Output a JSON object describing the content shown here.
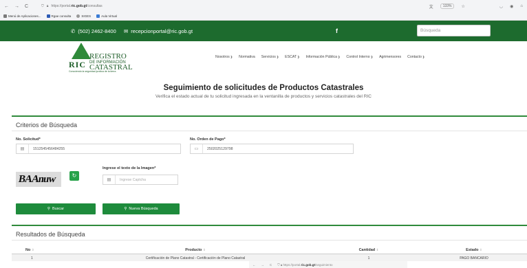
{
  "browser": {
    "nav": [
      "←",
      "→",
      "C"
    ],
    "url_prefix": "https://portal.",
    "url_host": "ric.gob.gt",
    "url_path": "/consultas",
    "zoom": "133%",
    "bookmarks": [
      "Menú de Aplicaciones...",
      "Rgae consulta",
      "SIGES",
      "Aula Virtual"
    ]
  },
  "topbar": {
    "phone": "(502) 2462-8400",
    "email": "recepcionportal@ric.gob.gt",
    "facebook": "f",
    "search_placeholder": "Búsqueda"
  },
  "logo": {
    "line1": "REGISTRO",
    "line2": "DE INFORMACIÓN",
    "line3": "CATASTRAL",
    "ric": "RIC",
    "tagline": "Conociendo la seguridad jurídica de la tierra"
  },
  "menu": [
    "Nosotros",
    "Normativa",
    "Servicios",
    "ESCAT",
    "Información Pública",
    "Control Interno",
    "Agrimensores",
    "Contacto"
  ],
  "page": {
    "title": "Seguimiento de solicitudes de Productos Catastrales",
    "subtitle": "Verifica el estado actual de tu solicitud ingresada en la ventanilla de productos y servicios catastrales del RIC"
  },
  "criteria": {
    "title": "Criterios de Búsqueda",
    "solicitud_label": "No. Solicitud*",
    "solicitud_value": "1512545456484255",
    "orden_label": "No. Orden de Pago*",
    "orden_value": "2502025129798",
    "captcha_label": "Ingrese el texto de la Imagen*",
    "captcha_placeholder": "Ingrese Captcha",
    "captcha_text": "BAAnuw",
    "buscar": "Buscar",
    "nueva": "Nueva Búsqueda"
  },
  "results": {
    "title": "Resultados de Búsqueda",
    "headers": [
      "No",
      "Producto",
      "Cantidad",
      "Estado"
    ],
    "rows": [
      {
        "no": "1",
        "producto": "Certificación de Plano Catastral - Certificación de Plano Catastral",
        "cantidad": "1",
        "estado": "PAGO BANCARIO"
      }
    ]
  },
  "mini_url": {
    "nav": [
      "←",
      "→",
      "C"
    ],
    "prefix": "https://portal.",
    "host": "ric.gob.gt",
    "path": "/seguimiento"
  }
}
